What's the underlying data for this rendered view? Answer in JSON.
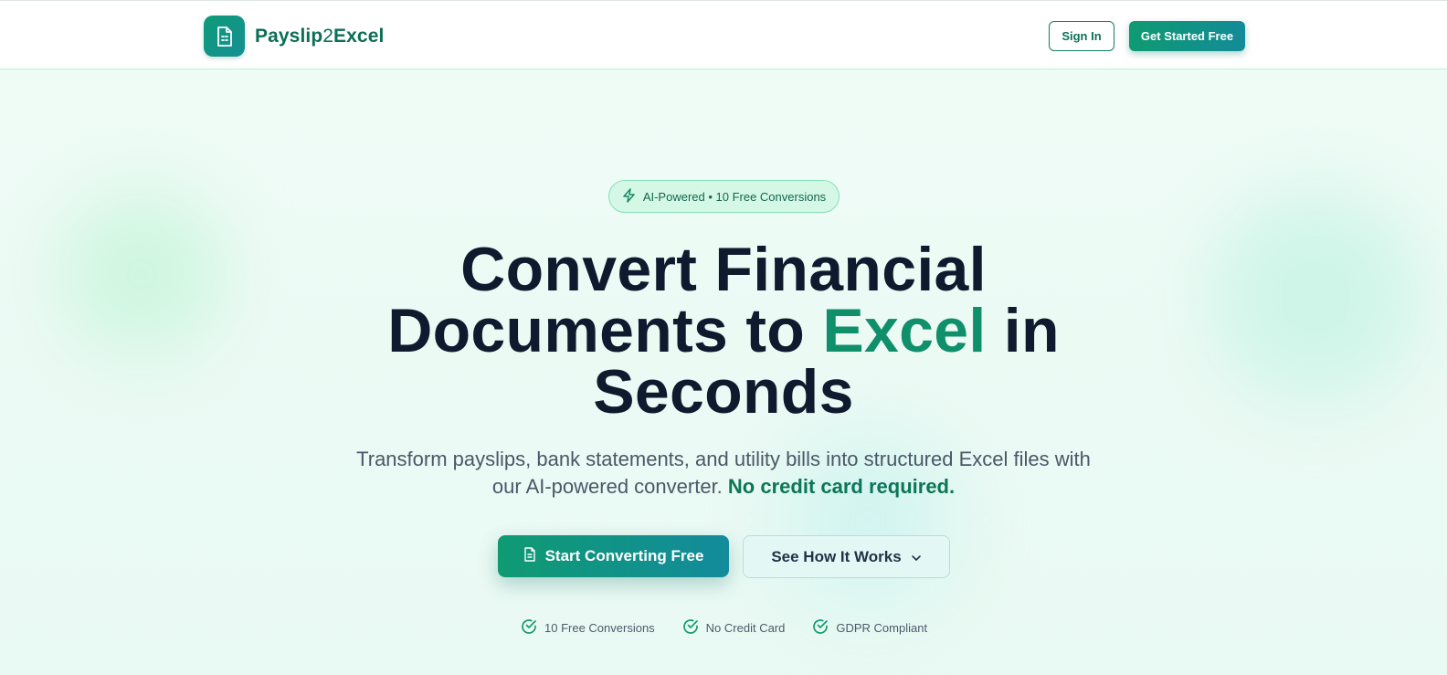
{
  "header": {
    "brand": {
      "prefix": "Payslip",
      "number": "2",
      "suffix": "Excel",
      "icon": "document-icon"
    },
    "sign_in_label": "Sign In",
    "get_started_label": "Get Started Free"
  },
  "badge": {
    "icon": "lightning-icon",
    "text": "AI-Powered • 10 Free Conversions"
  },
  "hero": {
    "title_line1": "Convert Financial",
    "title_line2_pre": "Documents to",
    "title_accent": "Excel",
    "title_line2_post": "in",
    "title_line3": "Seconds",
    "subtitle_line1": "Transform payslips, bank statements, and utility bills into structured Excel files with",
    "subtitle_line2": "our AI-powered converter.",
    "subtitle_highlight": "No credit card required."
  },
  "cta": {
    "primary_label": "Start Converting Free",
    "primary_icon": "file-icon",
    "secondary_label": "See How It Works",
    "secondary_icon": "chevron-down-icon"
  },
  "features": [
    {
      "icon": "check-circle-icon",
      "label": "10 Free Conversions"
    },
    {
      "icon": "check-circle-icon",
      "label": "No Credit Card"
    },
    {
      "icon": "check-circle-icon",
      "label": "GDPR Compliant"
    }
  ],
  "colors": {
    "brand_green": "#0f8f6a",
    "dark_text": "#101a2e",
    "button_gradient_start": "#0f9a72",
    "button_gradient_end": "#138b98"
  }
}
